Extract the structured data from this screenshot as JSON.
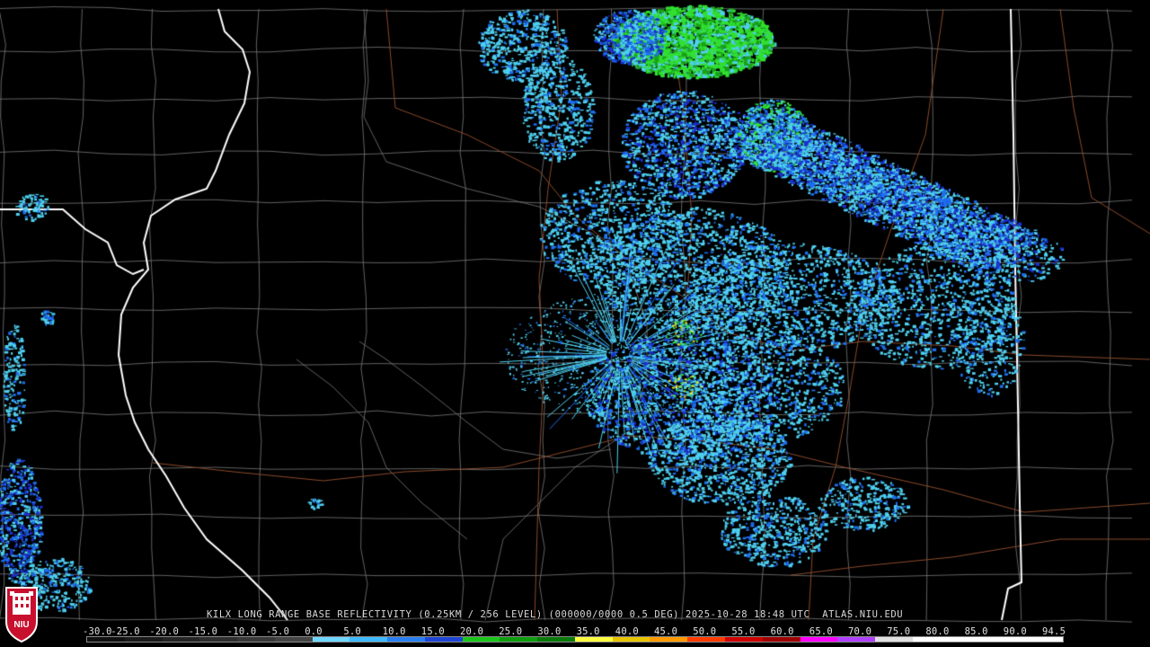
{
  "caption": {
    "text": "KILX LONG RANGE BASE REFLECTIVITY (0.25KM / 256 LEVEL) (000000/0000 0.5 DEG) 2025-10-28 18:48 UTC  ATLAS.NIU.EDU"
  },
  "legend": {
    "ticks": [
      "-30.0",
      "-25.0",
      "-20.0",
      "-15.0",
      "-10.0",
      "-5.0",
      "0.0",
      "5.0",
      "10.0",
      "15.0",
      "20.0",
      "25.0",
      "30.0",
      "35.0",
      "40.0",
      "45.0",
      "50.0",
      "55.0",
      "60.0",
      "65.0",
      "70.0",
      "75.0",
      "80.0",
      "85.0",
      "90.0",
      "94.5"
    ],
    "colors": [
      "#101010",
      "#1a1a1a",
      "#242424",
      "#2e2e2e",
      "#383838",
      "#444444",
      "#6fd6ff",
      "#3fb9ff",
      "#2a7ff0",
      "#1f45d6",
      "#19c619",
      "#0e9e0e",
      "#0a7a0a",
      "#ffff40",
      "#e8c400",
      "#ff9a00",
      "#ff3c00",
      "#d00000",
      "#a00000",
      "#ff00ff",
      "#b040ff",
      "#e0e0e0",
      "#ffffff",
      "#ffffff",
      "#ffffff",
      "#ffffff"
    ]
  },
  "logo": {
    "text": "NIU"
  },
  "map": {
    "state_line_color": "#ffffff",
    "county_line_color": "#7a7a7a",
    "highway_color": "#8b4a2b",
    "echo_colors": {
      "light": "#4fd0f0",
      "medium": "#1e6ef0",
      "deep": "#1b2fd0",
      "green": "#30e030",
      "darkgreen": "#1aa01a",
      "yellow": "#e8e830"
    }
  }
}
